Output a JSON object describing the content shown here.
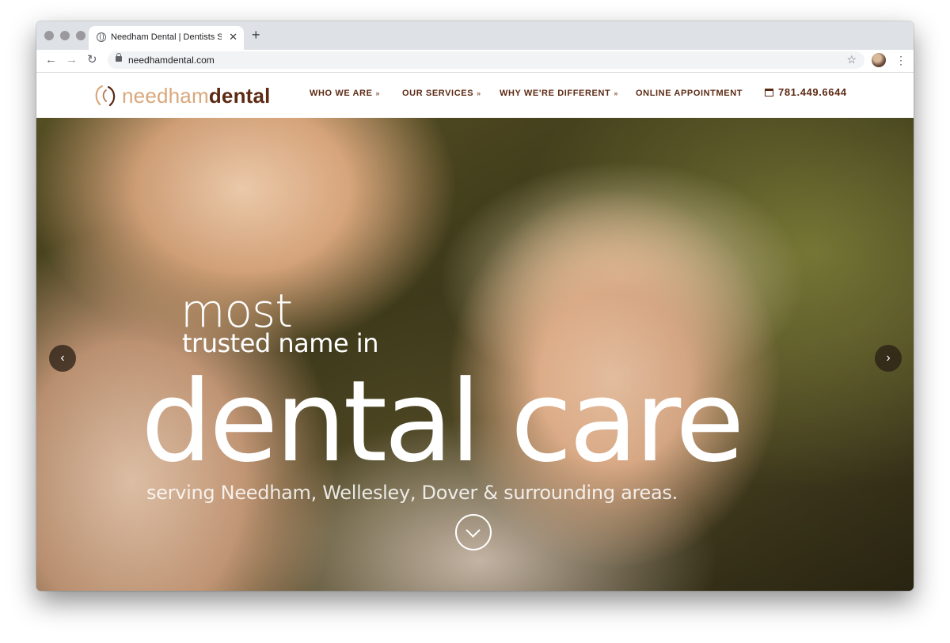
{
  "browser": {
    "tab_title": "Needham Dental | Dentists Ser",
    "tab_close": "✕",
    "new_tab": "+",
    "url": "needhamdental.com",
    "back": "←",
    "forward": "→",
    "reload": "↻",
    "bookmark": "☆",
    "menu": "⋮"
  },
  "site": {
    "logo": {
      "part1": "needham",
      "part2": "dental"
    },
    "nav": [
      {
        "label": "WHO WE ARE",
        "chevron": "»"
      },
      {
        "label": "OUR SERVICES",
        "chevron": "»"
      },
      {
        "label": "WHY WE'RE DIFFERENT",
        "chevron": "»"
      },
      {
        "label": "ONLINE APPOINTMENT"
      }
    ],
    "phone": "781.449.6644"
  },
  "hero": {
    "line1": "most",
    "line2": "trusted name in",
    "line3": "dental care",
    "line4": "serving Needham, Wellesley, Dover & surrounding areas.",
    "prev_arrow": "‹",
    "next_arrow": "›"
  },
  "colors": {
    "brand_dark": "#5c2a14",
    "brand_light": "#d9a77a"
  }
}
